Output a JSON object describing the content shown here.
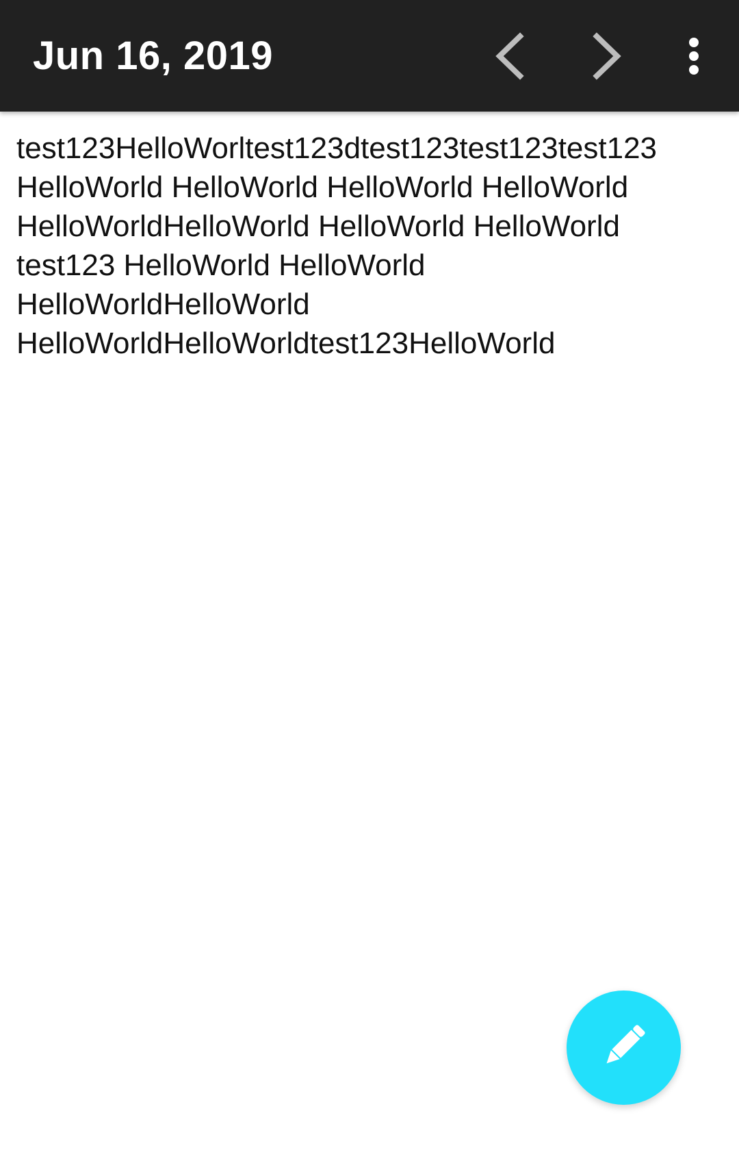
{
  "toolbar": {
    "title": "Jun 16, 2019",
    "prev_icon": "chevron-left-icon",
    "next_icon": "chevron-right-icon",
    "menu_icon": "more-vertical-icon",
    "background_color": "#212121",
    "icon_color": "#bdbdbd"
  },
  "note": {
    "text": "test123HelloWorltest123dtest123test123test123\nHelloWorld HelloWorld HelloWorld HelloWorld\nHelloWorldHelloWorld HelloWorld HelloWorld\ntest123 HelloWorld HelloWorld\nHelloWorldHelloWorld\nHelloWorldHelloWorldtest123HelloWorld"
  },
  "fab": {
    "icon": "pencil-icon",
    "color": "#22e0fb"
  }
}
